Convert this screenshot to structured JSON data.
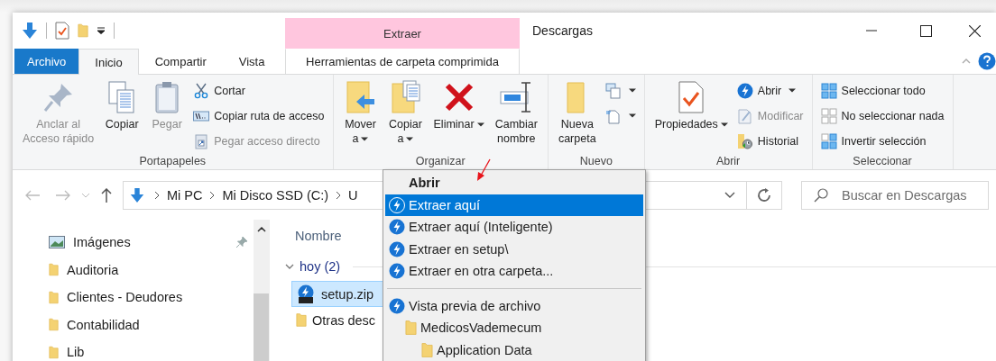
{
  "window": {
    "title": "Descargas"
  },
  "contextual_tab": {
    "label": "Extraer"
  },
  "tabs": [
    {
      "label": "Archivo",
      "kind": "file",
      "selected": false
    },
    {
      "label": "Inicio",
      "kind": "tab",
      "selected": true
    },
    {
      "label": "Compartir",
      "kind": "tab",
      "selected": false
    },
    {
      "label": "Vista",
      "kind": "tab",
      "selected": false
    },
    {
      "label": "Herramientas de carpeta comprimida",
      "kind": "contextual",
      "selected": false
    }
  ],
  "ribbon": {
    "groups": [
      {
        "label": "Portapapeles",
        "large": [
          {
            "label": "Anclar al\nAcceso rápido",
            "kind": "pin",
            "disabled": true,
            "dropdown": false
          },
          {
            "label": "Copiar",
            "kind": "copy",
            "disabled": false,
            "dropdown": false
          },
          {
            "label": "Pegar",
            "kind": "paste",
            "disabled": true,
            "dropdown": false
          }
        ],
        "small": [
          {
            "label": "Cortar",
            "kind": "cut",
            "disabled": false,
            "dropdown": false
          },
          {
            "label": "Copiar ruta de acceso",
            "kind": "copy-path",
            "disabled": false,
            "dropdown": false
          },
          {
            "label": "Pegar acceso directo",
            "kind": "paste-shortcut",
            "disabled": true,
            "dropdown": false
          }
        ]
      },
      {
        "label": "Organizar",
        "large": [
          {
            "label": "Mover\na",
            "kind": "move-to",
            "disabled": false,
            "dropdown": true
          },
          {
            "label": "Copiar\na",
            "kind": "copy-to",
            "disabled": false,
            "dropdown": true
          },
          {
            "label": "Eliminar",
            "kind": "delete",
            "disabled": false,
            "dropdown": true
          },
          {
            "label": "Cambiar\nnombre",
            "kind": "rename",
            "disabled": false,
            "dropdown": false
          }
        ]
      },
      {
        "label": "Nuevo",
        "large": [
          {
            "label": "Nueva\ncarpeta",
            "kind": "new-folder",
            "disabled": false,
            "dropdown": false
          }
        ],
        "small": [
          {
            "kind": "new-item",
            "dropdown": true
          },
          {
            "kind": "easy-access",
            "dropdown": true
          }
        ]
      },
      {
        "label": "Abrir",
        "large": [
          {
            "label": "Propiedades",
            "kind": "properties",
            "disabled": false,
            "dropdown": true
          }
        ],
        "small": [
          {
            "label": "Abrir",
            "kind": "open",
            "disabled": false,
            "dropdown": true
          },
          {
            "label": "Modificar",
            "kind": "edit",
            "disabled": true,
            "dropdown": false
          },
          {
            "label": "Historial",
            "kind": "history",
            "disabled": false,
            "dropdown": false
          }
        ]
      },
      {
        "label": "Seleccionar",
        "small": [
          {
            "label": "Seleccionar todo",
            "kind": "select-all",
            "disabled": false,
            "dropdown": false
          },
          {
            "label": "No seleccionar nada",
            "kind": "select-none",
            "disabled": false,
            "dropdown": false
          },
          {
            "label": "Invertir selección",
            "kind": "invert",
            "disabled": false,
            "dropdown": false
          }
        ]
      }
    ]
  },
  "address_bar": {
    "crumbs": [
      "Mi PC",
      "Mi Disco SSD (C:)",
      "U"
    ]
  },
  "search": {
    "placeholder": "Buscar en Descargas"
  },
  "navigation": {
    "items": [
      {
        "label": "Imágenes",
        "kind": "pictures",
        "pinned": true
      },
      {
        "label": "Auditoria",
        "kind": "folder",
        "pinned": false
      },
      {
        "label": "Clientes - Deudores",
        "kind": "folder",
        "pinned": false
      },
      {
        "label": "Contabilidad",
        "kind": "folder",
        "pinned": false
      },
      {
        "label": "Lib",
        "kind": "folder",
        "pinned": false
      }
    ]
  },
  "file_list": {
    "columns": [
      "Nombre"
    ],
    "groups": [
      {
        "label": "hoy (2)",
        "expanded": true,
        "files": [
          {
            "name": "setup.zip",
            "kind": "zip",
            "selected": true
          },
          {
            "name": "Otras desc",
            "kind": "folder",
            "selected": false
          }
        ]
      }
    ]
  },
  "context_menu": {
    "items": [
      {
        "label": "Abrir",
        "kind": "default",
        "selected": false
      },
      {
        "label": "Extraer aquí",
        "kind": "action",
        "selected": true
      },
      {
        "label": "Extraer aquí (Inteligente)",
        "kind": "action",
        "selected": false
      },
      {
        "label": "Extraer en setup\\",
        "kind": "action",
        "selected": false
      },
      {
        "label": "Extraer en otra carpeta...",
        "kind": "action",
        "selected": false
      },
      {
        "kind": "separator"
      },
      {
        "label": "Vista previa de archivo",
        "kind": "action",
        "selected": false,
        "children": [
          {
            "label": "MedicosVademecum",
            "kind": "folder",
            "selected": false,
            "children": [
              {
                "label": "Application Data",
                "kind": "folder",
                "selected": false
              }
            ]
          }
        ]
      }
    ]
  }
}
